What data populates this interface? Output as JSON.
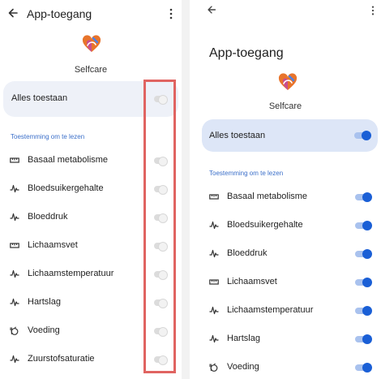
{
  "left": {
    "title": "App-toegang",
    "app_name": "Selfcare",
    "allow_all_label": "Alles toestaan",
    "section_label": "Toestemming om te lezen",
    "items": [
      {
        "label": "Basaal metabolisme",
        "icon": "ruler-icon"
      },
      {
        "label": "Bloedsuikergehalte",
        "icon": "vitals-icon"
      },
      {
        "label": "Bloeddruk",
        "icon": "vitals-icon"
      },
      {
        "label": "Lichaamsvet",
        "icon": "ruler-icon"
      },
      {
        "label": "Lichaamstemperatuur",
        "icon": "vitals-icon"
      },
      {
        "label": "Hartslag",
        "icon": "vitals-icon"
      },
      {
        "label": "Voeding",
        "icon": "nutrition-icon"
      },
      {
        "label": "Zuurstofsaturatie",
        "icon": "vitals-icon"
      }
    ],
    "toggle_state": "off"
  },
  "right": {
    "title": "App-toegang",
    "app_name": "Selfcare",
    "allow_all_label": "Alles toestaan",
    "section_label": "Toestemming om te lezen",
    "items": [
      {
        "label": "Basaal metabolisme",
        "icon": "ruler-icon"
      },
      {
        "label": "Bloedsuikergehalte",
        "icon": "vitals-icon"
      },
      {
        "label": "Bloeddruk",
        "icon": "vitals-icon"
      },
      {
        "label": "Lichaamsvet",
        "icon": "ruler-icon"
      },
      {
        "label": "Lichaamstemperatuur",
        "icon": "vitals-icon"
      },
      {
        "label": "Hartslag",
        "icon": "vitals-icon"
      },
      {
        "label": "Voeding",
        "icon": "nutrition-icon"
      }
    ],
    "toggle_state": "on"
  },
  "colors": {
    "accent": "#1a5fd6",
    "highlight_border": "#e06461",
    "section_label": "#3b6fc9"
  }
}
